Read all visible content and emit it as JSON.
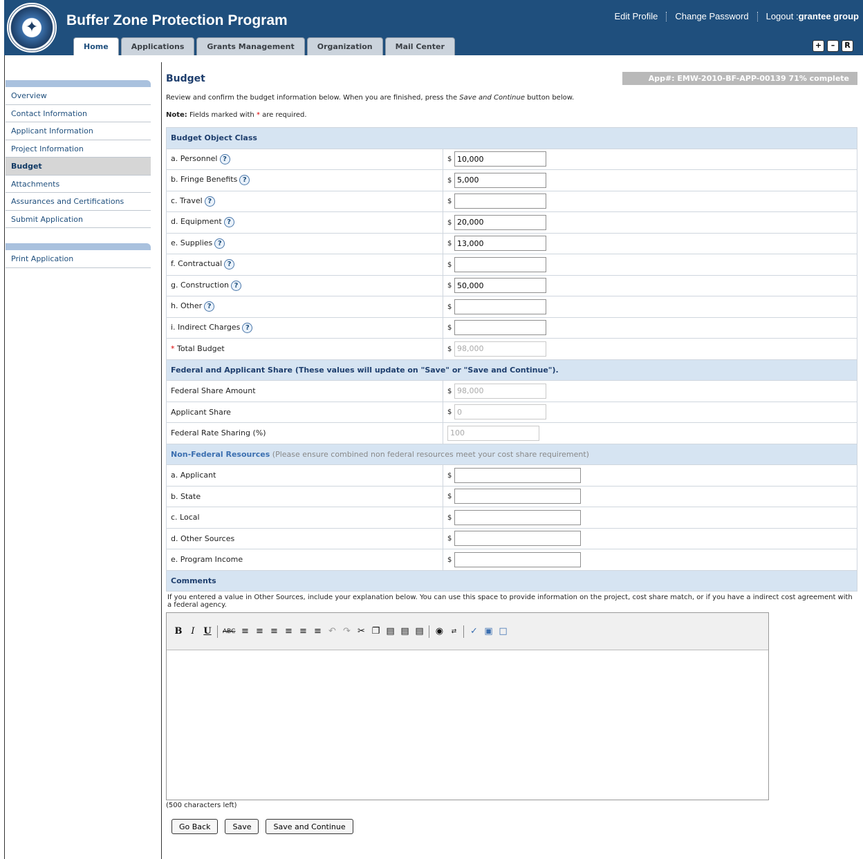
{
  "header": {
    "title": "Buffer Zone Protection Program",
    "links": {
      "edit_profile": "Edit Profile",
      "change_password": "Change Password",
      "logout": "Logout :",
      "user": "grantee group"
    },
    "tabs": [
      "Home",
      "Applications",
      "Grants Management",
      "Organization",
      "Mail Center"
    ],
    "size_buttons": [
      "+",
      "–",
      "R"
    ]
  },
  "sidebar": {
    "items": [
      "Overview",
      "Contact Information",
      "Applicant Information",
      "Project Information",
      "Budget",
      "Attachments",
      "Assurances and Certifications",
      "Submit Application"
    ],
    "active_index": 4,
    "print": "Print Application"
  },
  "main": {
    "title": "Budget",
    "app_badge": "App#: EMW-2010-BF-APP-00139 71% complete",
    "intro_pre": "Review and confirm the budget information below. When you are finished, press the ",
    "intro_em": "Save and Continue",
    "intro_post": " button below.",
    "note_label": "Note:",
    "note_pre": " Fields marked with ",
    "note_star": "*",
    "note_post": " are required."
  },
  "budget": {
    "section": "Budget Object Class",
    "currency": "$",
    "rows": [
      {
        "label": "a. Personnel",
        "value": "10,000"
      },
      {
        "label": "b. Fringe Benefits",
        "value": "5,000"
      },
      {
        "label": "c. Travel",
        "value": ""
      },
      {
        "label": "d. Equipment",
        "value": "20,000"
      },
      {
        "label": "e. Supplies",
        "value": "13,000"
      },
      {
        "label": "f. Contractual",
        "value": ""
      },
      {
        "label": "g. Construction",
        "value": "50,000"
      },
      {
        "label": "h. Other",
        "value": ""
      },
      {
        "label": "i. Indirect Charges",
        "value": ""
      }
    ],
    "total_star": "*",
    "total_label": " Total Budget",
    "total_value": "98,000"
  },
  "share": {
    "section": "Federal and Applicant Share (These values will update on \"Save\" or \"Save and Continue\").",
    "federal_label": "Federal Share Amount",
    "federal_value": "98,000",
    "applicant_label": "Applicant Share",
    "applicant_value": "0",
    "rate_label": "Federal Rate Sharing (%)",
    "rate_value": "100"
  },
  "nonfederal": {
    "title": "Non-Federal Resources",
    "note": " (Please ensure combined non federal resources meet your cost share requirement)",
    "rows": [
      "a. Applicant",
      "b. State",
      "c. Local",
      "d. Other Sources",
      "e. Program Income"
    ]
  },
  "comments": {
    "section": "Comments",
    "desc": "If you entered a value in Other Sources, include your explanation below. You can use this space to provide information on the project, cost share match, or if you have a indirect cost agreement with a federal agency.",
    "chars_left": "(500 characters left)",
    "toolbar_icons": [
      "bold-icon",
      "italic-icon",
      "underline-icon",
      "strikethrough-icon",
      "align-left-icon",
      "align-center-icon",
      "align-right-icon",
      "justify-icon",
      "bullet-list-icon",
      "numbered-list-icon",
      "undo-icon",
      "redo-icon",
      "cut-icon",
      "copy-icon",
      "paste-icon",
      "paste-text-icon",
      "paste-word-icon",
      "find-icon",
      "replace-icon",
      "spellcheck-icon",
      "source-icon",
      "preview-icon"
    ]
  },
  "buttons": {
    "back": "Go Back",
    "save": "Save",
    "save_continue": "Save and Continue"
  }
}
